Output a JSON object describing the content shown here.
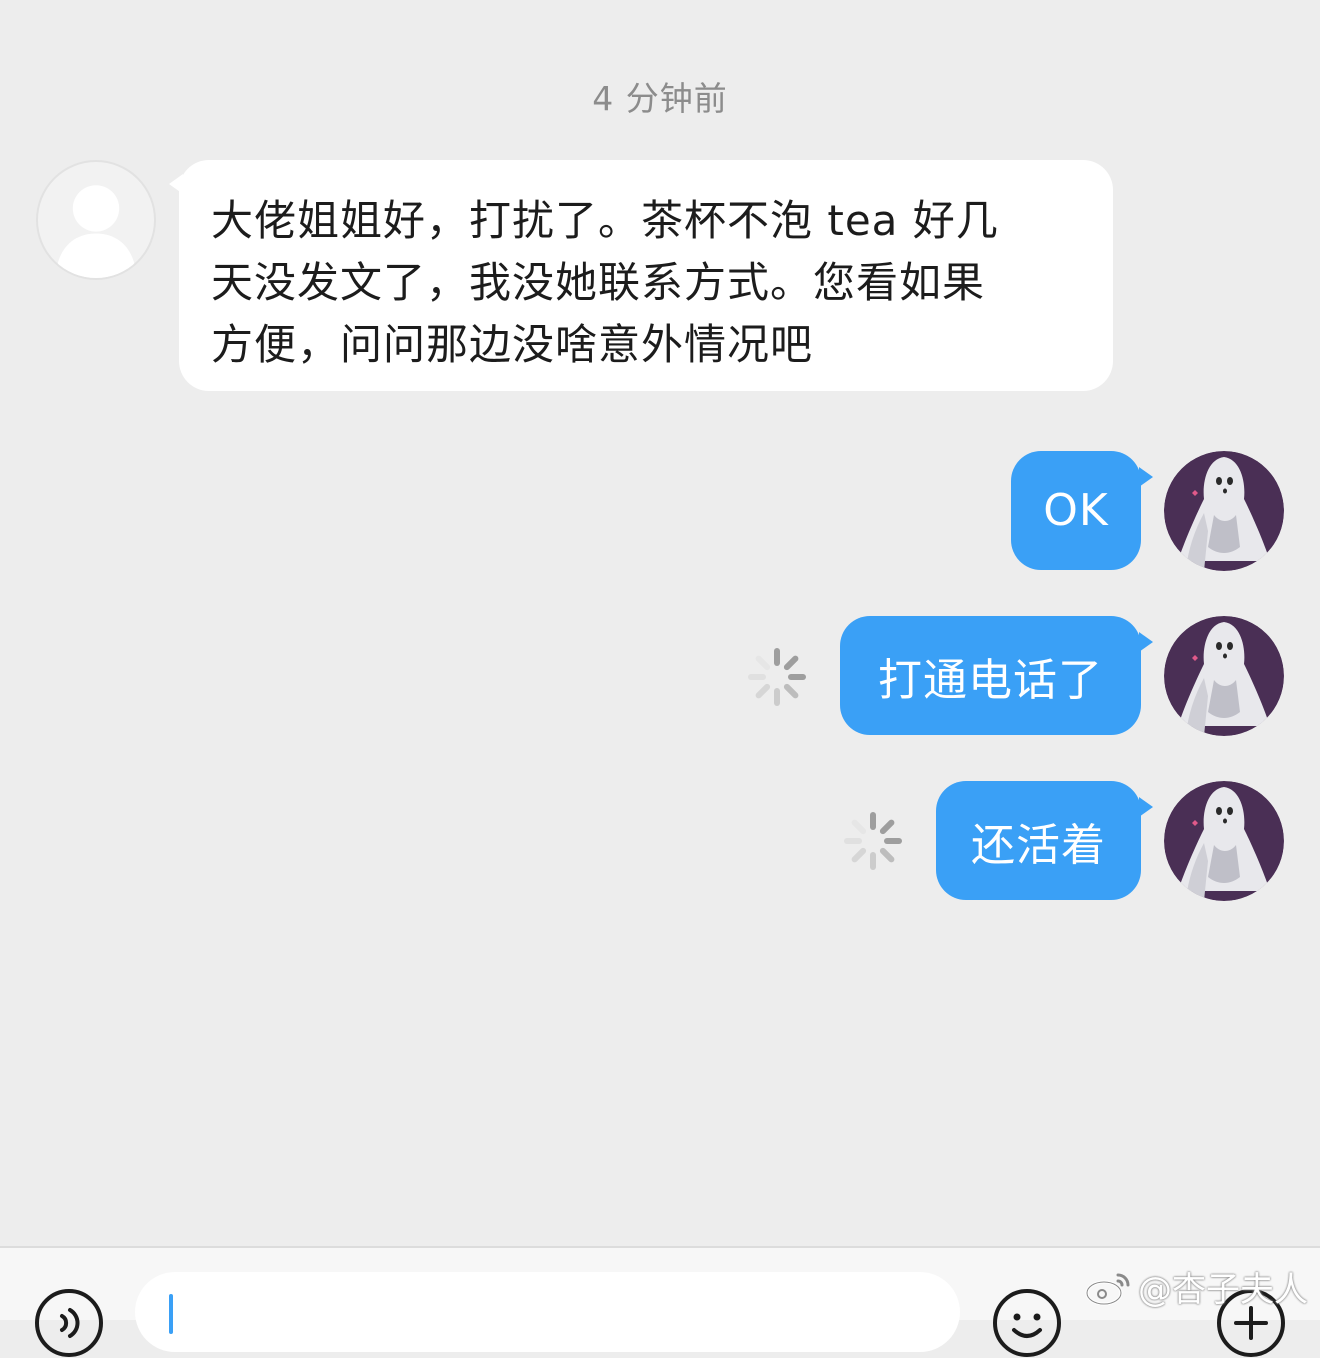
{
  "timestamp": "4 分钟前",
  "incoming": {
    "line1": "大佬姐姐好，打扰了。茶杯不泡 tea 好几",
    "line2": "天没发文了，我没她联系方式。您看如果",
    "line3": "方便，问问那边没啥意外情况吧"
  },
  "outgoing": [
    {
      "text": "OK",
      "status": "sent"
    },
    {
      "text": "打通电话了",
      "status": "sending"
    },
    {
      "text": "还活着",
      "status": "sending"
    }
  ],
  "watermark": "@杏子夫人",
  "icons": {
    "voice": "voice-icon",
    "emoji": "emoji-icon",
    "plus": "plus-icon",
    "spinner": "loading-spinner-icon",
    "weibo": "weibo-logo-icon"
  },
  "colors": {
    "background": "#ededed",
    "outgoing_bubble": "#3aa0f6",
    "incoming_bubble": "#ffffff",
    "timestamp_text": "#8c8c8c"
  }
}
